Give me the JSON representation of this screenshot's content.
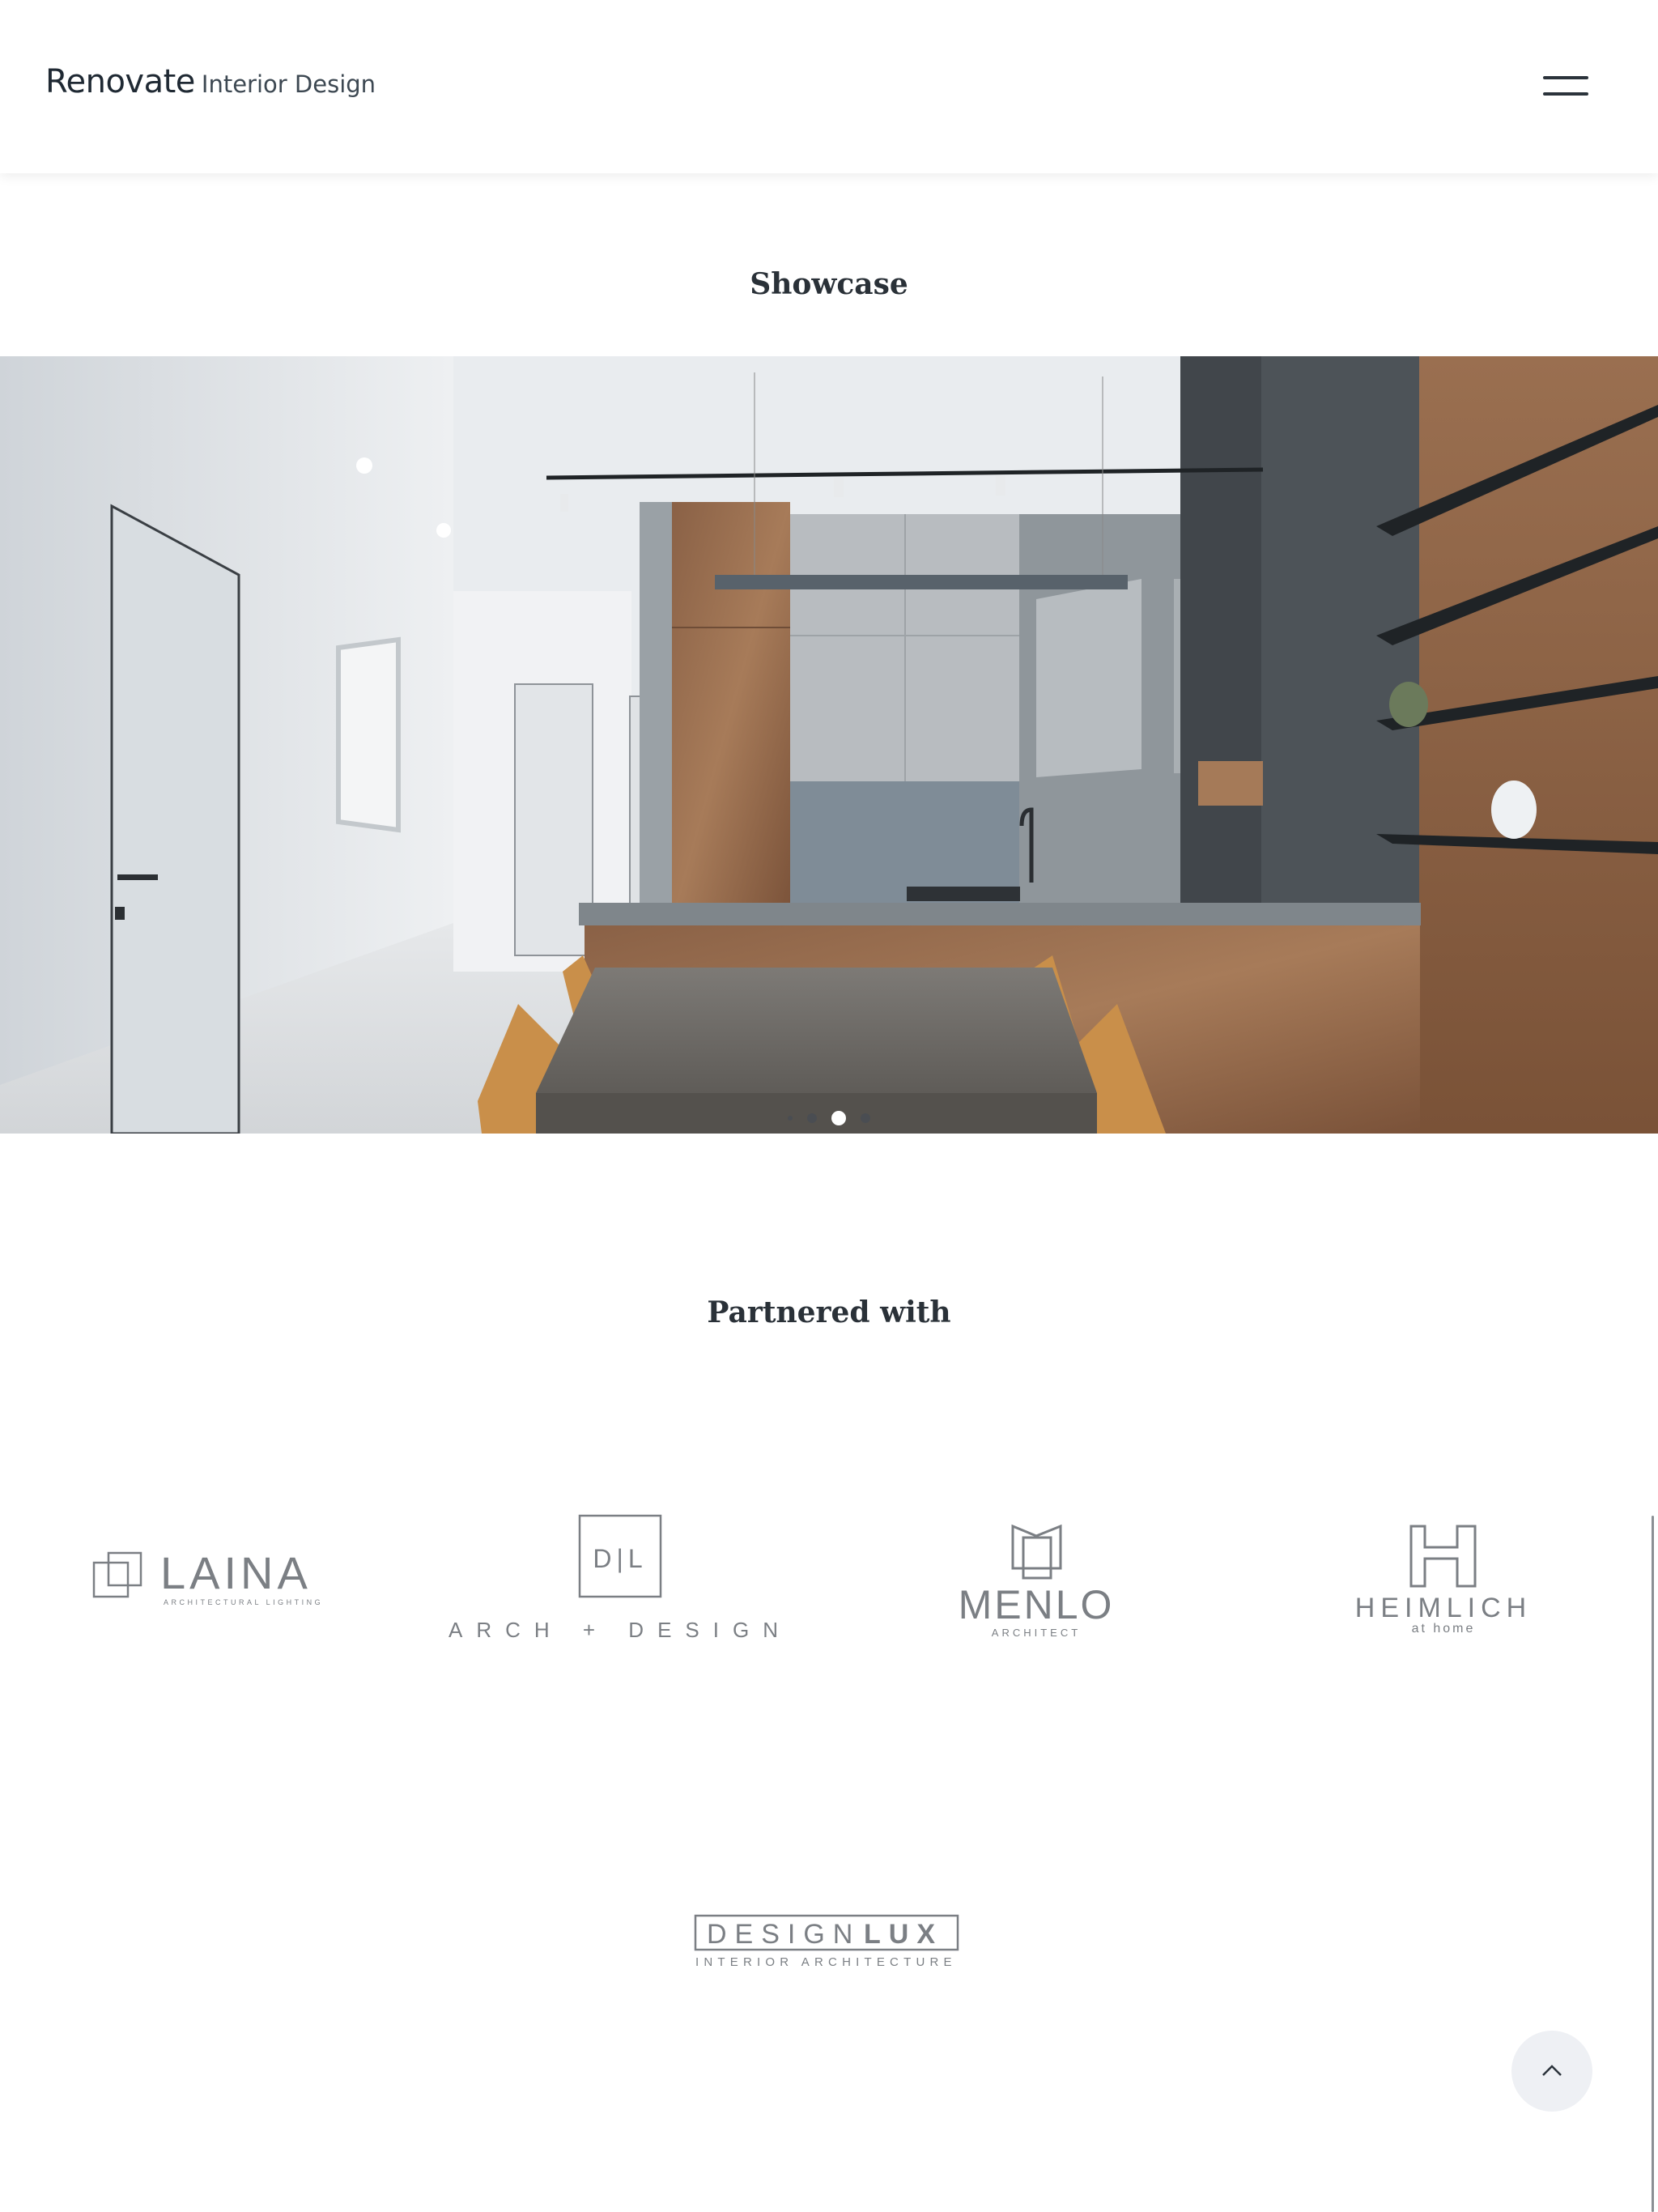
{
  "header": {
    "brand_name": "Renovate",
    "brand_tagline": "Interior Design",
    "menu_icon": "hamburger-menu-icon"
  },
  "showcase": {
    "title": "Showcase",
    "slide_count": 4,
    "active_slide": 3
  },
  "partners": {
    "title": "Partnered with",
    "logos": [
      {
        "name": "LAINA",
        "tagline": "ARCHITECTURAL LIGHTING"
      },
      {
        "name": "D|L",
        "tagline": "ARCH + DESIGN"
      },
      {
        "name": "MENLO",
        "tagline": "ARCHITECT"
      },
      {
        "name": "HEIMLICH",
        "tagline": "at home"
      },
      {
        "name": "DESIGNLUX",
        "name_part_light": "DESIGN",
        "name_part_bold": "LUX",
        "tagline": "INTERIOR ARCHITECTURE"
      }
    ]
  },
  "scroll_top": {
    "icon": "chevron-up-icon"
  },
  "colors": {
    "text_dark": "#1f2933",
    "logo_gray": "#7b7f84",
    "button_bg": "#eef0f4"
  }
}
